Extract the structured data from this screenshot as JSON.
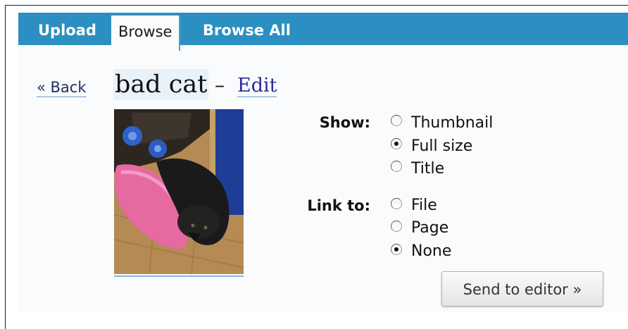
{
  "tabs": [
    {
      "label": "Upload"
    },
    {
      "label": "Browse"
    },
    {
      "label": "Browse All"
    }
  ],
  "back_label": "« Back",
  "image_title": "bad cat",
  "title_separator": "–",
  "edit_label": "Edit",
  "show": {
    "label": "Show:",
    "options": [
      "Thumbnail",
      "Full size",
      "Title"
    ],
    "selected": "Full size"
  },
  "link_to": {
    "label": "Link to:",
    "options": [
      "File",
      "Page",
      "None"
    ],
    "selected": "None"
  },
  "send_button_label": "Send to editor »",
  "colors": {
    "tab_bar": "#2b8fc1",
    "link": "#2a2aa0"
  }
}
